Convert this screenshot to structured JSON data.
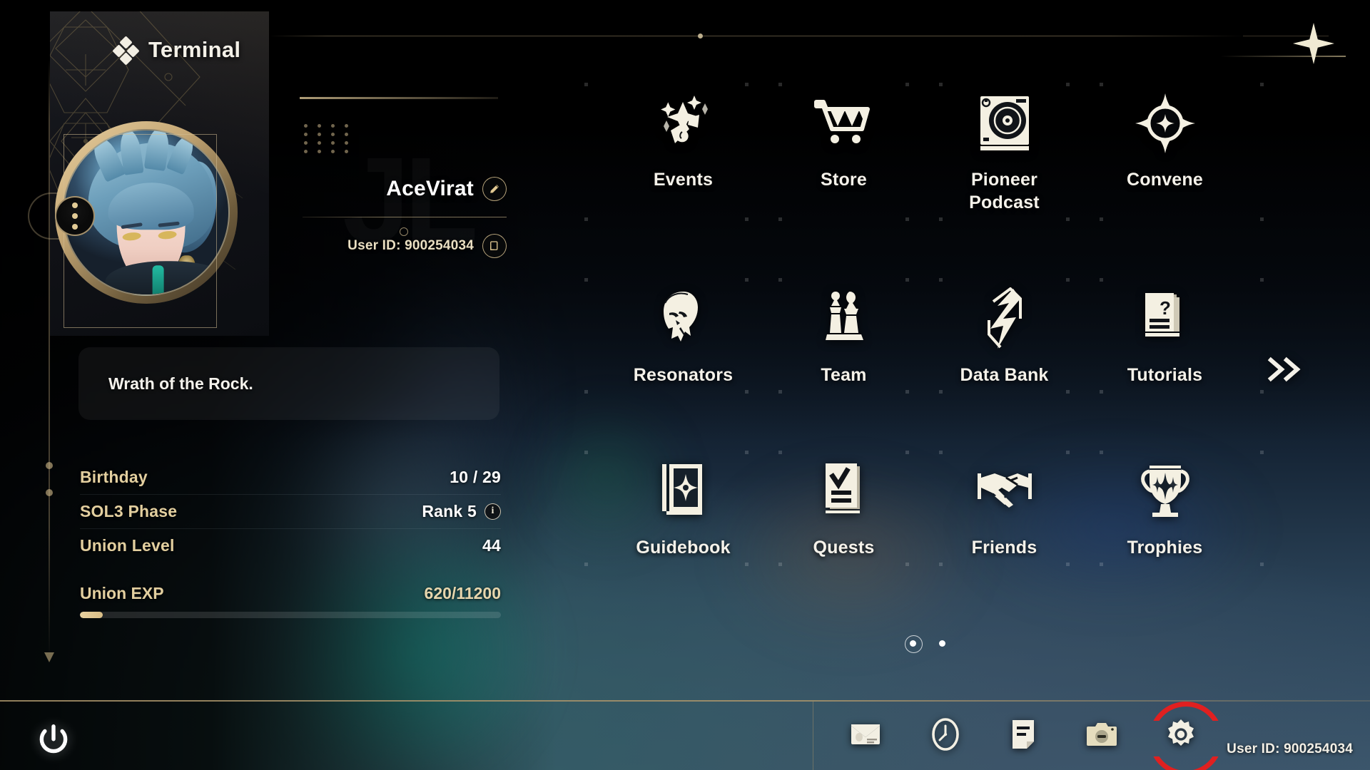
{
  "header": {
    "title": "Terminal",
    "logo_icon": "diamond-cluster-icon",
    "close_icon": "close-star-icon"
  },
  "profile": {
    "avatar_menu_icon": "more-vertical-icon",
    "username": "AceVirat",
    "edit_icon": "pencil-edit-icon",
    "user_id_label": "User ID: 900254034",
    "copy_icon": "copy-icon",
    "signature": "Wrath of the Rock.",
    "stats": [
      {
        "label": "Birthday",
        "value": "10 / 29",
        "info": false
      },
      {
        "label": "SOL3 Phase",
        "value": "Rank 5",
        "info": true
      },
      {
        "label": "Union Level",
        "value": "44",
        "info": false
      }
    ],
    "exp": {
      "label": "Union EXP",
      "value": "620/11200",
      "current": 620,
      "max": 11200,
      "percent": 5.5
    }
  },
  "menu": {
    "tiles": [
      {
        "label": "Events",
        "icon": "events-confetti-icon"
      },
      {
        "label": "Store",
        "icon": "shopping-cart-icon"
      },
      {
        "label": "Pioneer\nPodcast",
        "icon": "podcast-turntable-icon"
      },
      {
        "label": "Convene",
        "icon": "convene-star-compass-icon"
      },
      {
        "label": "Resonators",
        "icon": "resonator-character-head-icon"
      },
      {
        "label": "Team",
        "icon": "chess-pieces-icon"
      },
      {
        "label": "Data Bank",
        "icon": "data-bank-emblem-icon"
      },
      {
        "label": "Tutorials",
        "icon": "question-pages-icon"
      },
      {
        "label": "Guidebook",
        "icon": "compass-book-icon"
      },
      {
        "label": "Quests",
        "icon": "quest-checklist-icon"
      },
      {
        "label": "Friends",
        "icon": "handshake-icon"
      },
      {
        "label": "Trophies",
        "icon": "trophy-icon"
      }
    ],
    "next_page_icon": "double-chevron-right-icon",
    "pages": 2,
    "active_page": 1
  },
  "bottom_bar": {
    "power_icon": "power-icon",
    "tray": [
      {
        "name": "mail",
        "icon": "envelope-icon",
        "highlighted": false
      },
      {
        "name": "clock",
        "icon": "clock-compass-icon",
        "highlighted": false
      },
      {
        "name": "notes",
        "icon": "note-document-icon",
        "highlighted": false
      },
      {
        "name": "screenshot",
        "icon": "camera-icon",
        "highlighted": true
      },
      {
        "name": "settings",
        "icon": "gear-icon",
        "highlighted": false
      }
    ],
    "user_id": "User ID: 900254034"
  },
  "colors": {
    "gold": "#e3cf9f",
    "cream": "#f2efe6",
    "accent_red": "#e02020",
    "bar_fill": "#e8d1a0"
  }
}
